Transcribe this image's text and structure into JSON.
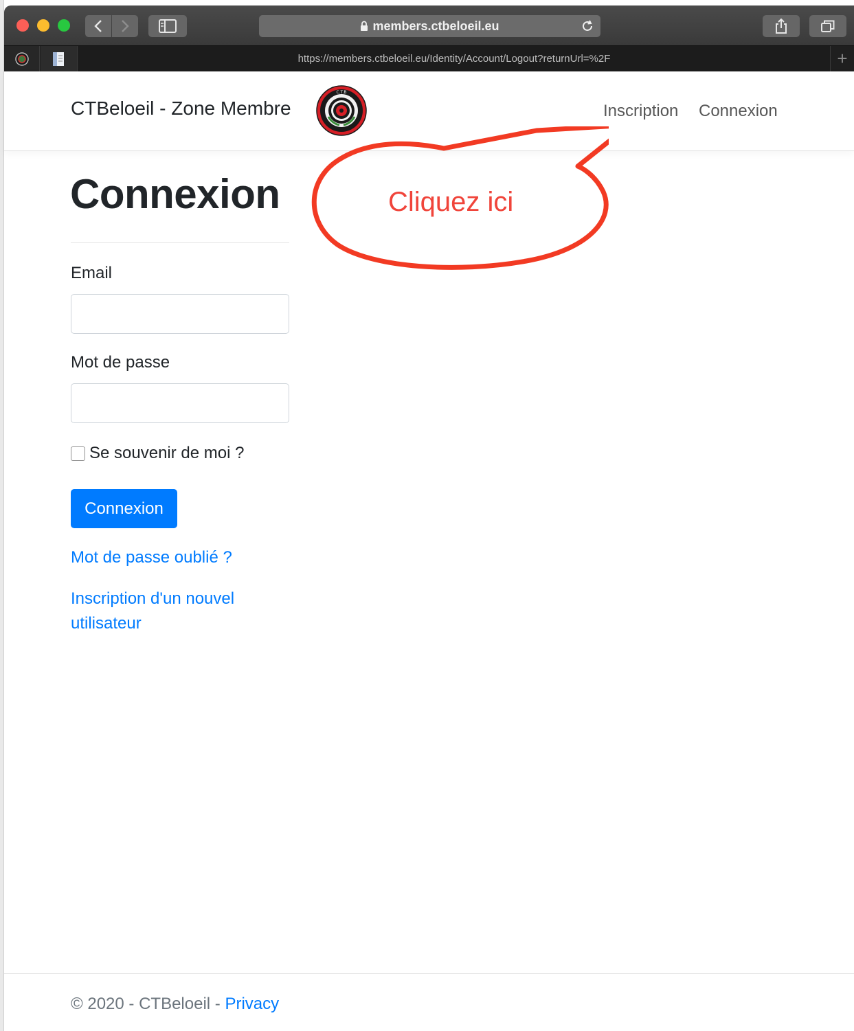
{
  "browser": {
    "address": "members.ctbeloeil.eu",
    "tab_url": "https://members.ctbeloeil.eu/Identity/Account/Logout?returnUrl=%2F"
  },
  "navbar": {
    "brand": "CTBeloeil - Zone Membre",
    "links": [
      "Inscription",
      "Connexion"
    ]
  },
  "main": {
    "heading": "Connexion",
    "email_label": "Email",
    "email_value": "",
    "password_label": "Mot de passe",
    "password_value": "",
    "remember_label": "Se souvenir de moi ?",
    "remember_checked": false,
    "submit_label": "Connexion",
    "forgot_link": "Mot de passe oublié ?",
    "register_link": "Inscription d'un nouvel utilisateur"
  },
  "annotation": {
    "text": "Cliquez ici",
    "color": "#f0443a"
  },
  "footer": {
    "copyright": "© 2020 - CTBeloeil - ",
    "privacy_link": "Privacy"
  },
  "colors": {
    "primary": "#007bff",
    "text": "#212529",
    "muted": "#6c757d"
  }
}
